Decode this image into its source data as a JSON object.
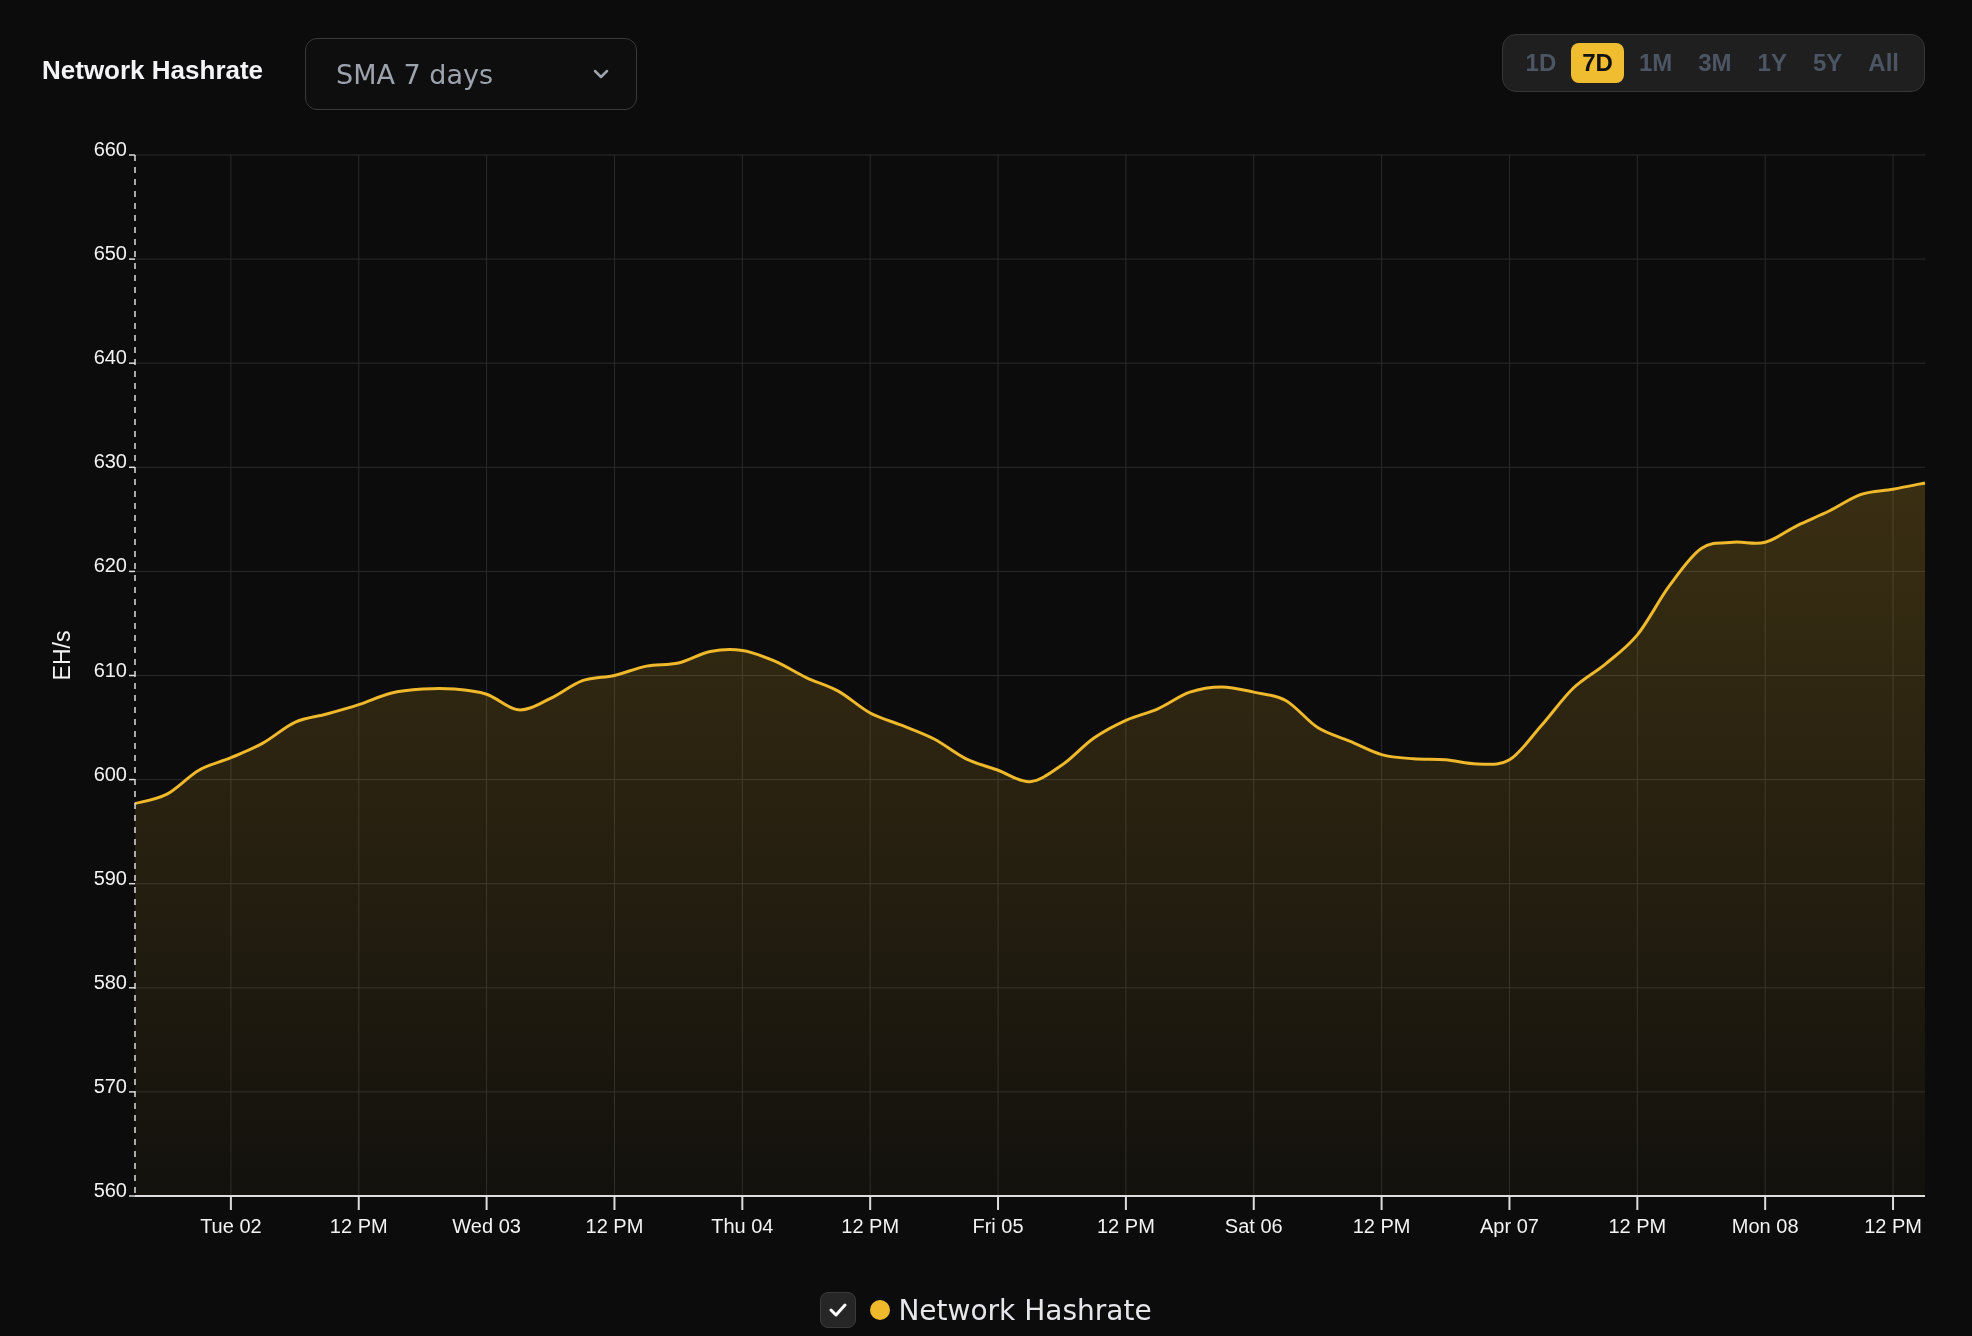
{
  "header": {
    "title": "Network Hashrate",
    "dropdown": {
      "value": "SMA 7 days"
    },
    "ranges": [
      {
        "label": "1D",
        "selected": false
      },
      {
        "label": "7D",
        "selected": true
      },
      {
        "label": "1M",
        "selected": false
      },
      {
        "label": "3M",
        "selected": false
      },
      {
        "label": "1Y",
        "selected": false
      },
      {
        "label": "5Y",
        "selected": false
      },
      {
        "label": "All",
        "selected": false
      }
    ]
  },
  "chart": {
    "chart_data": {
      "type": "area",
      "ylabel": "EH/s",
      "grid": true,
      "ylim": [
        560,
        660
      ],
      "yticks": [
        560,
        570,
        580,
        590,
        600,
        610,
        620,
        630,
        640,
        650,
        660
      ],
      "categories": [
        null,
        null,
        null,
        "Tue 02",
        null,
        null,
        null,
        "12 PM",
        null,
        null,
        null,
        "Wed 03",
        null,
        null,
        null,
        "12 PM",
        null,
        null,
        null,
        "Thu 04",
        null,
        null,
        null,
        "12 PM",
        null,
        null,
        null,
        "Fri 05",
        null,
        null,
        null,
        "12 PM",
        null,
        null,
        null,
        "Sat 06",
        null,
        null,
        null,
        "12 PM",
        null,
        null,
        null,
        "Apr 07",
        null,
        null,
        null,
        "12 PM",
        null,
        null,
        null,
        "Mon 08",
        null,
        null,
        null,
        "12 PM",
        null
      ],
      "series": [
        {
          "name": "Network Hashrate",
          "color": "#f0b92b",
          "values": [
            597.7,
            598.6,
            600.9,
            602.1,
            603.5,
            605.5,
            606.3,
            607.2,
            608.3,
            608.7,
            608.7,
            608.2,
            606.7,
            607.8,
            609.5,
            610,
            610.9,
            611.2,
            612.3,
            612.4,
            611.4,
            609.8,
            608.5,
            606.4,
            605.2,
            603.9,
            602,
            600.9,
            599.8,
            601.4,
            604,
            605.7,
            606.8,
            608.4,
            608.9,
            608.4,
            607.6,
            605,
            603.7,
            602.4,
            602,
            601.9,
            601.5,
            601.9,
            605.2,
            608.8,
            611.1,
            613.9,
            618.6,
            622.2,
            622.8,
            622.8,
            624.4,
            625.8,
            627.4,
            627.9,
            628.5
          ]
        }
      ]
    },
    "legend": {
      "checked": true
    }
  }
}
